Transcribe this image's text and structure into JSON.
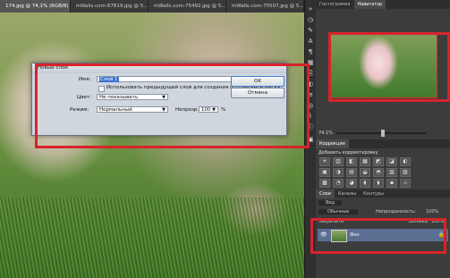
{
  "document_tabs": [
    {
      "label": "174.jpg @ 74,1% (RGB/8)",
      "close": "×",
      "active": true
    },
    {
      "label": "mWalls.com-67819.jpg @ 5...",
      "close": "×",
      "active": false
    },
    {
      "label": "mWalls.com-75492.jpg @ 5...",
      "close": "×",
      "active": false
    },
    {
      "label": "mWalls.com-75507.jpg @ 5...",
      "close": "×",
      "active": false
    }
  ],
  "panels": {
    "top_tabs": [
      "Гистограмма",
      "Навигатор"
    ],
    "navigator_zoom": "74.1%",
    "adjustments_tab": "Коррекция",
    "adjustments_title": "Добавить корректировку",
    "adjustment_icons": [
      "☀",
      "▥",
      "◧",
      "▦",
      "◩",
      "◪",
      "◐",
      "▣",
      "◑",
      "▤",
      "◒",
      "◓",
      "▧",
      "▨",
      "▩",
      "◔",
      "◕",
      "◖",
      "◗",
      "▪",
      "▫"
    ],
    "layer_tabs": [
      "Слои",
      "Каналы",
      "Контуры"
    ],
    "filter_label": "Вид",
    "blend_mode": "Обычные",
    "opacity_label": "Непрозрачность:",
    "opacity_value": "100%",
    "lock_label": "Закрепить:",
    "fill_label": "Заливка:",
    "fill_value": "100%",
    "layer_name": "Фон",
    "layer_visible_icon": "👁",
    "layer_lock_icon": "🔒"
  },
  "dialog": {
    "title": "Новый слой",
    "name_label": "Имя:",
    "name_value": "Слой 1",
    "clipping_mask_label": "Использовать предыдущий слой для создания обтравочной маски",
    "color_label": "Цвет:",
    "color_value": "Не показывать",
    "mode_label": "Режим:",
    "mode_value": "Нормальный",
    "opacity_label": "Непрозр.:",
    "opacity_value": "100",
    "percent": "%",
    "ok_label": "OK",
    "cancel_label": "Отмена"
  },
  "colors": {
    "highlight_red": "#d8232b",
    "selected_layer": "#5a6e92",
    "selection_blue": "#3a6fd1"
  }
}
